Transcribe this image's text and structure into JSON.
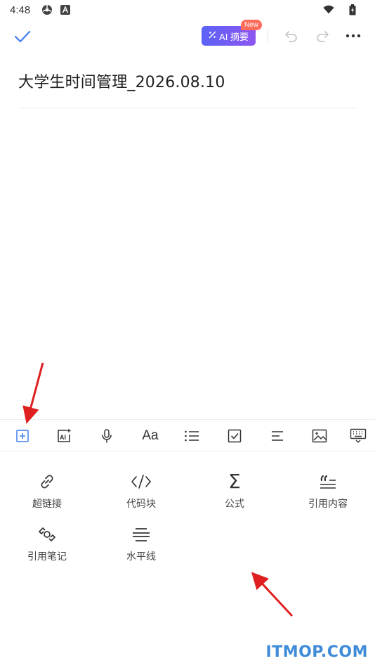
{
  "status_bar": {
    "time": "4:48",
    "icons": [
      "vpn-icon",
      "app-a-icon",
      "wifi-icon",
      "battery-icon"
    ]
  },
  "toolbar": {
    "ai_label": "AI 摘要",
    "new_badge": "New",
    "icons": [
      "check-icon",
      "undo-icon",
      "redo-icon",
      "more-icon"
    ]
  },
  "document": {
    "title": "大学生时间管理_2026.08.10"
  },
  "format_bar": {
    "items": [
      {
        "name": "insert-icon",
        "active": true
      },
      {
        "name": "ai-write-icon"
      },
      {
        "name": "microphone-icon"
      },
      {
        "name": "text-style-icon",
        "text": "Aa"
      },
      {
        "name": "bullet-list-icon"
      },
      {
        "name": "checkbox-icon"
      },
      {
        "name": "align-icon"
      },
      {
        "name": "image-icon"
      },
      {
        "name": "keyboard-icon"
      }
    ]
  },
  "insert_panel": {
    "items": [
      {
        "label": "超链接",
        "icon": "link-icon"
      },
      {
        "label": "代码块",
        "icon": "code-icon"
      },
      {
        "label": "公式",
        "icon": "sigma-icon",
        "glyph": "Σ"
      },
      {
        "label": "引用内容",
        "icon": "quote-icon"
      },
      {
        "label": "引用笔记",
        "icon": "note-link-icon"
      },
      {
        "label": "水平线",
        "icon": "horizontal-rule-icon"
      }
    ]
  },
  "watermark": "ITMOP.COM",
  "colors": {
    "accent": "#3e7ef0",
    "ai_gradient_start": "#5b63f6",
    "ai_gradient_end": "#8d55f0",
    "badge": "#ff6b5a",
    "annotation_arrow": "#e02020",
    "watermark": "#3f8bd8"
  }
}
